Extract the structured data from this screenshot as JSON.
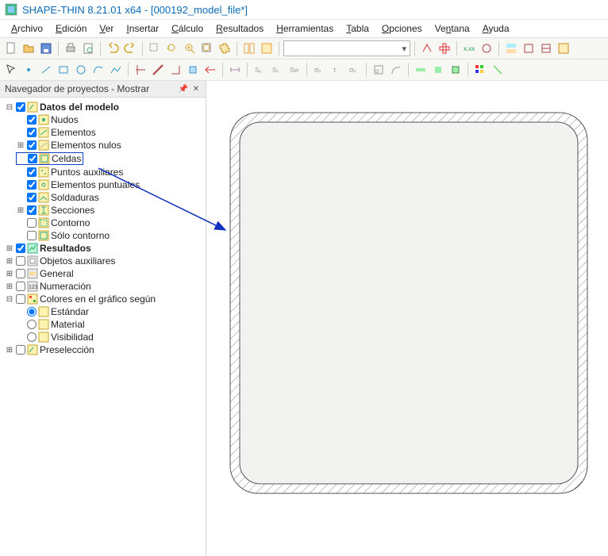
{
  "app": {
    "title": "SHAPE-THIN 8.21.01 x64 - [000192_model_file*]"
  },
  "menus": [
    {
      "key": "archivo",
      "pre": "",
      "u": "A",
      "post": "rchivo"
    },
    {
      "key": "edicion",
      "pre": "",
      "u": "E",
      "post": "dición"
    },
    {
      "key": "ver",
      "pre": "",
      "u": "V",
      "post": "er"
    },
    {
      "key": "insertar",
      "pre": "",
      "u": "I",
      "post": "nsertar"
    },
    {
      "key": "calculo",
      "pre": "",
      "u": "C",
      "post": "álculo"
    },
    {
      "key": "resultados",
      "pre": "",
      "u": "R",
      "post": "esultados"
    },
    {
      "key": "herramientas",
      "pre": "",
      "u": "H",
      "post": "erramientas"
    },
    {
      "key": "tabla",
      "pre": "",
      "u": "T",
      "post": "abla"
    },
    {
      "key": "opciones",
      "pre": "",
      "u": "O",
      "post": "pciones"
    },
    {
      "key": "ventana",
      "pre": "Ve",
      "u": "n",
      "post": "tana"
    },
    {
      "key": "ayuda",
      "pre": "",
      "u": "A",
      "post": "yuda"
    }
  ],
  "panel": {
    "title": "Navegador de proyectos - Mostrar"
  },
  "tree": {
    "datos_del_modelo": "Datos del modelo",
    "nudos": "Nudos",
    "elementos": "Elementos",
    "elementos_nulos": "Elementos nulos",
    "celdas": "Celdas",
    "puntos_auxiliares": "Puntos auxiliares",
    "elementos_puntuales": "Elementos puntuales",
    "soldaduras": "Soldaduras",
    "secciones": "Secciones",
    "contorno": "Contorno",
    "solo_contorno": "Sólo contorno",
    "resultados": "Resultados",
    "objetos_auxiliares": "Objetos auxiliares",
    "general": "General",
    "numeracion": "Numeración",
    "colores_grafico": "Colores en el gráfico según",
    "estandar": "Estándar",
    "material": "Material",
    "visibilidad": "Visibilidad",
    "preseleccion": "Preselección"
  },
  "toolbar": {
    "combo_placeholder": ""
  }
}
